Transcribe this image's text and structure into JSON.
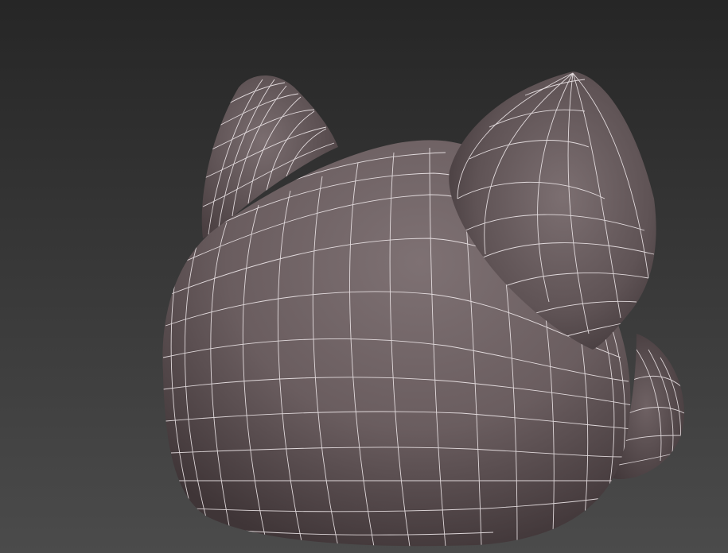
{
  "viewport": {
    "background_top": "#2a2a2a",
    "background_bottom": "#4a4a4a",
    "mesh_base_color": "#6a5d5f",
    "mesh_highlight_color": "#857779",
    "mesh_shadow_color": "#3a3133",
    "wireframe_color": "#efe8ea",
    "object": "cat-head-mesh"
  }
}
